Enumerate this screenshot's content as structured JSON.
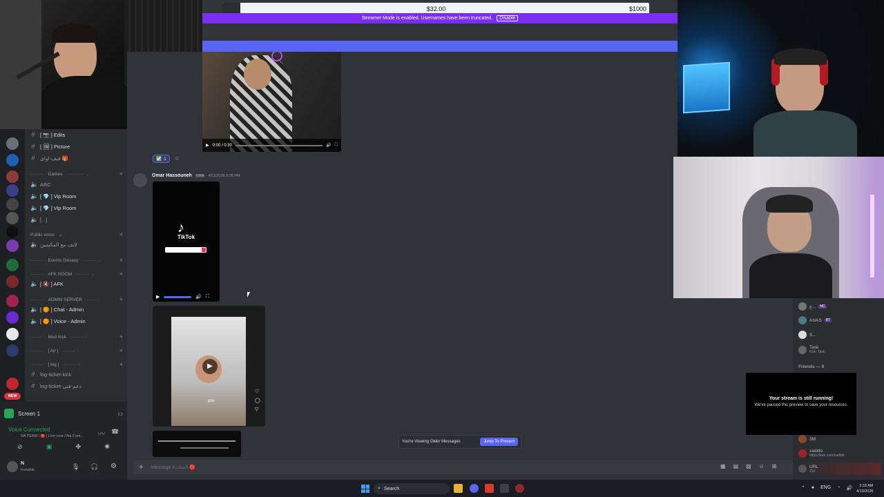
{
  "donation": {
    "current": "$32.00",
    "goal": "$1000"
  },
  "streamer_mode": {
    "text": "Streamer Mode is enabled. Usernames have been truncated.",
    "disable_label": "Disable"
  },
  "video1": {
    "time": "0:00 / 0:30",
    "reaction_count": "1"
  },
  "message": {
    "author": "Omar Hassouneh",
    "tag": "NWA",
    "timestamp": "4/11/2026 9:26 PM",
    "tiktok_label": "TikTok",
    "overlay_text": "pov"
  },
  "channels": [
    {
      "icon": "#",
      "name": "[ 📷 ] Edits"
    },
    {
      "icon": "#",
      "name": "[ 🖼 ] Picture"
    },
    {
      "icon": "#",
      "name": "قيف-اواي 🎁"
    },
    {
      "category": "Games"
    },
    {
      "icon": "voice",
      "name": "ARC"
    },
    {
      "icon": "voice",
      "name": "[ 💎 ] Vip Room"
    },
    {
      "icon": "voice",
      "name": "[ 💎 ] Vip Room"
    },
    {
      "icon": "voice",
      "name": "[ . ]"
    },
    {
      "category": "Public voice"
    },
    {
      "icon": "voice",
      "name": "لايف مع المكيمين"
    },
    {
      "category": "Events Gevaoy"
    },
    {
      "category": "AFK ROOM"
    },
    {
      "icon": "voice",
      "name": "[ 🔇 ] AFK"
    },
    {
      "category": "ADMIN SERVER"
    },
    {
      "icon": "voice",
      "name": "[ 🟠 ] Chat - Admin"
    },
    {
      "icon": "voice",
      "name": "[ 🟠 ] Voice - Admin"
    },
    {
      "category": "Mod Kick"
    },
    {
      "category": "[ Ajr ]"
    },
    {
      "category": "[ log ]"
    },
    {
      "icon": "#",
      "name": "log-ticket-kick"
    },
    {
      "icon": "#",
      "name": "log-ticket-دعم-فني"
    }
  ],
  "rail_badge": "NEW",
  "screen_share": {
    "label": "Screen 1"
  },
  "voice": {
    "status": "Voice Connected",
    "detail": "NA TEAM / 🔴 | Live now / Na Com..."
  },
  "user": {
    "name": "N",
    "status": "Invisible"
  },
  "older_messages": {
    "text": "You're Viewing Older Messages",
    "button": "Jump To Present"
  },
  "composer": {
    "placeholder": "Message #الشات 🔴"
  },
  "members": [
    {
      "name": "ع...",
      "badge": "NC"
    },
    {
      "name": "ANAS",
      "badge": "RT"
    },
    {
      "name": "S..."
    },
    {
      "name": "Task",
      "sub": "Kick: Task"
    }
  ],
  "friends_header": "Friends — 9",
  "members_lower": [
    {
      "name": "3M"
    },
    {
      "name": "zadido",
      "sub": "https://kick.com/zadido"
    },
    {
      "name": "URL",
      "sub": "212"
    }
  ],
  "stream_paused": {
    "title": "Your stream is still running!",
    "text": "We've paused this preview to save your resources."
  },
  "taskbar": {
    "search": "Search",
    "lang": "ENG",
    "time": "2:33 AM",
    "date": "4/13/2026"
  },
  "colors": {
    "accent": "#5865f2",
    "streamer": "#7a2ff0",
    "green": "#23a55a"
  }
}
